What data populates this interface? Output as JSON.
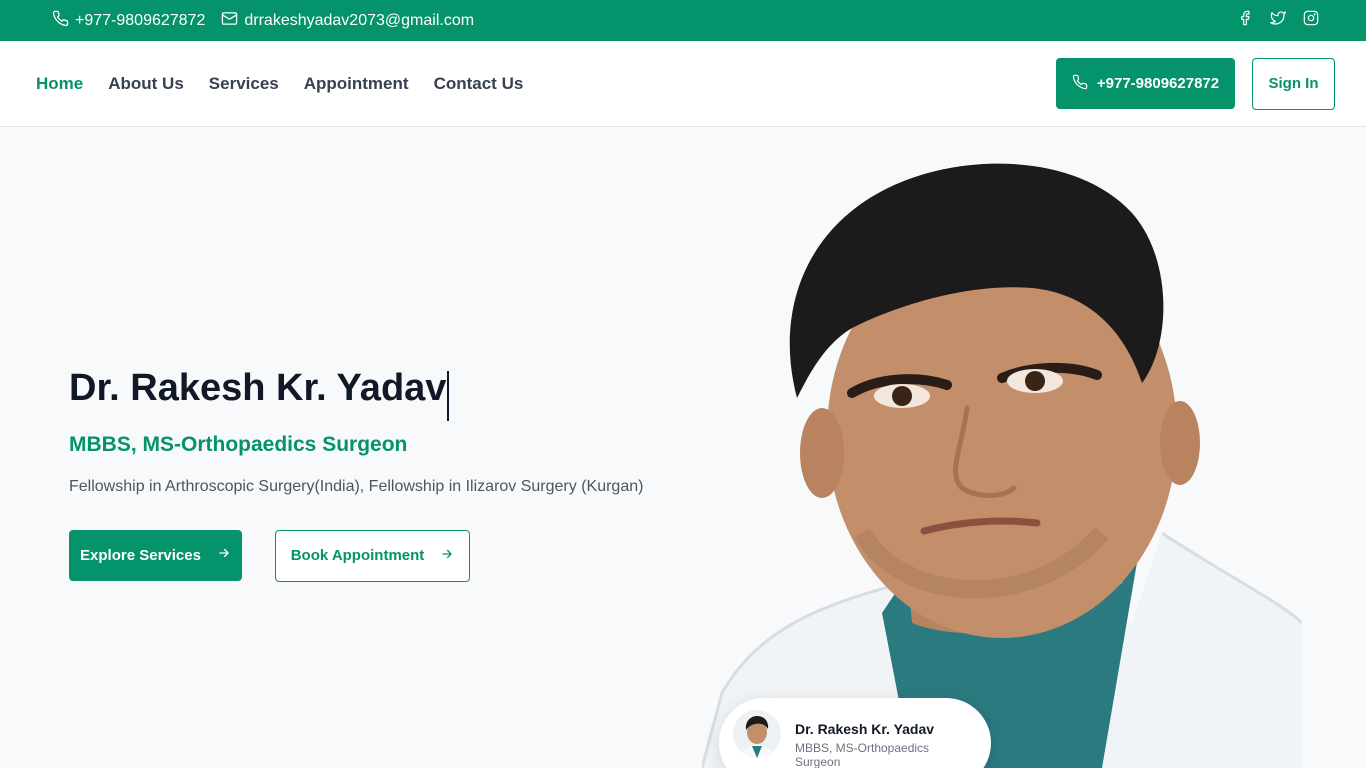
{
  "topbar": {
    "phone": "+977-9809627872",
    "email": "drrakeshyadav2073@gmail.com",
    "socials": [
      "facebook-icon",
      "twitter-icon",
      "instagram-icon"
    ]
  },
  "nav": {
    "links": [
      {
        "label": "Home",
        "active": true
      },
      {
        "label": "About Us"
      },
      {
        "label": "Services"
      },
      {
        "label": "Appointment"
      },
      {
        "label": "Contact Us"
      }
    ],
    "phone_button": "+977-9809627872",
    "signin_button": "Sign In"
  },
  "hero": {
    "name": "Dr. Rakesh Kr. Yadav",
    "degree": "MBBS, MS-Orthopaedics Surgeon",
    "fellowship": "Fellowship in Arthroscopic Surgery(India), Fellowship in Ilizarov Surgery (Kurgan)",
    "explore_button": "Explore Services",
    "book_button": "Book Appointment"
  },
  "doctor_card": {
    "name": "Dr. Rakesh Kr. Yadav",
    "degree": "MBBS, MS-Orthopaedics Surgeon"
  },
  "colors": {
    "brand": "#04936a",
    "text": "#111827",
    "background": "#f8f9fb"
  }
}
